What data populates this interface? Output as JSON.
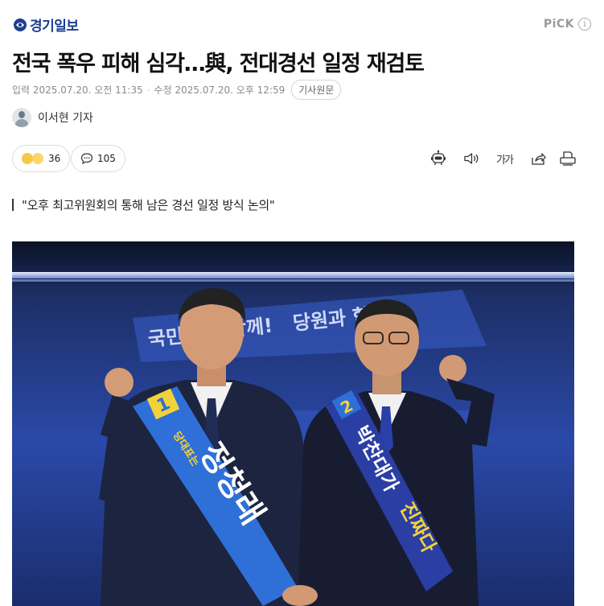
{
  "header": {
    "logo_text": "경기일보",
    "pick_label": "PiCK",
    "pick_info_glyph": "i"
  },
  "article": {
    "headline": "전국 폭우 피해 심각…與, 전대경선 일정 재검토",
    "published": "입력 2025.07.20. 오전 11:35",
    "modified": "수정 2025.07.20. 오후 12:59",
    "original_button": "기사원문",
    "reporter": "이서현 기자",
    "subtitle": "\"오후 최고위원회의 통해 남은 경선 일정 방식 논의\""
  },
  "actions": {
    "reactions_count": "36",
    "comments_count": "105",
    "font_label": "가가",
    "icons": [
      "robot-summary-icon",
      "speaker-icon",
      "font-size-icon",
      "share-icon",
      "print-icon"
    ]
  },
  "photo": {
    "banner_text_left": "국민",
    "banner_text_right": "당원과 함께!",
    "banner_text_mid": "함께!",
    "sash_left_number": "1",
    "sash_left_top": "당대표는",
    "sash_left_name": "정청래",
    "sash_right_number": "2",
    "sash_right_name": "박찬대가",
    "sash_right_slogan": "진짜다"
  },
  "colors": {
    "logo_blue": "#1a3f8f",
    "stage_navy": "#0b1a3a",
    "sash_blue": "#2f6fd8",
    "sash_yellow": "#f2d23a"
  }
}
